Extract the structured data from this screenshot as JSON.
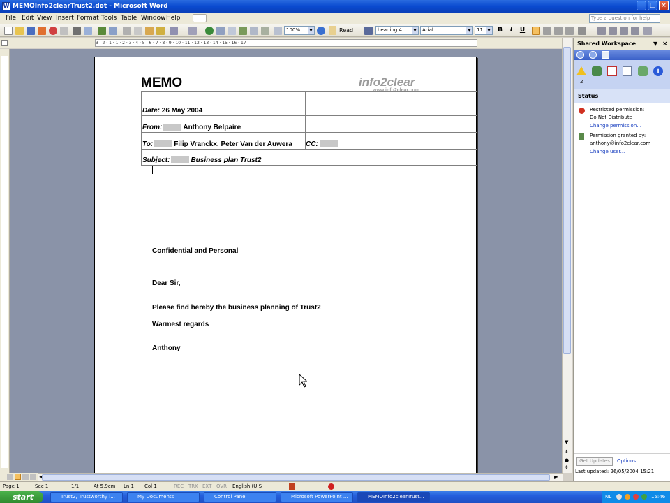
{
  "window": {
    "title": "MEMOInfo2clearTrust2.dot - Microsoft Word"
  },
  "menu": {
    "items": [
      "File",
      "Edit",
      "View",
      "Insert",
      "Format",
      "Tools",
      "Table",
      "Window",
      "Help"
    ],
    "help_placeholder": "Type a question for help"
  },
  "toolbar": {
    "zoom": "100%",
    "read_label": "Read",
    "style": "heading 4",
    "font": "Arial",
    "font_size": "11",
    "bold": "B",
    "italic": "I",
    "underline": "U"
  },
  "ruler": {
    "ticks": "3 · 2 · 1 · 1 · 2 · 3 · 4 · 5 · 6 · 7 · 8 · 9 · 10 · 11 · 12 · 13 · 14 · 15 · 16 · 17"
  },
  "document": {
    "memo_title": "MEMO",
    "logo_text": "info2clear",
    "logo_url": "www.info2clear.com",
    "date_label": "Date:",
    "date_value": "26 May 2004",
    "from_label": "From:",
    "from_value": "Anthony Belpaire",
    "to_label": "To:",
    "to_value": "Filip Vranckx, Peter Van der Auwera",
    "cc_label": "CC:",
    "subject_label": "Subject:",
    "subject_value": "Business plan Trust2",
    "body": [
      "Confidential and Personal",
      "Dear Sir,",
      "Please find hereby the business planning of Trust2",
      "Warmest regards",
      "Anthony"
    ]
  },
  "taskpane": {
    "title": "Shared Workspace",
    "badge_count": "2",
    "status_heading": "Status",
    "restricted_label": "Restricted permission:",
    "restricted_value": "Do Not Distribute",
    "change_permission": "Change permission...",
    "granted_label": "Permission granted by:",
    "granted_value": "anthony@info2clear.com",
    "change_user": "Change user...",
    "get_updates": "Get Updates",
    "options": "Options...",
    "last_updated": "Last updated: 26/05/2004 15:21"
  },
  "statusbar": {
    "page": "Page 1",
    "sec": "Sec 1",
    "pages": "1/1",
    "at": "At 5,9cm",
    "ln": "Ln 1",
    "col": "Col 1",
    "rec": "REC",
    "trk": "TRK",
    "ext": "EXT",
    "ovr": "OVR",
    "language": "English (U.S"
  },
  "taskbar": {
    "start": "start",
    "tasks": [
      "Trust2, Trustworthy i...",
      "My Documents",
      "Control Panel",
      "Microsoft PowerPoint ...",
      "MEMOInfo2clearTrust..."
    ],
    "tray_lang": "NL",
    "clock": "15:46"
  },
  "colors": {
    "title_blue": "#0a4bd0",
    "doc_bg": "#8a93a8",
    "taskpane_blue": "#c5d3f2"
  }
}
